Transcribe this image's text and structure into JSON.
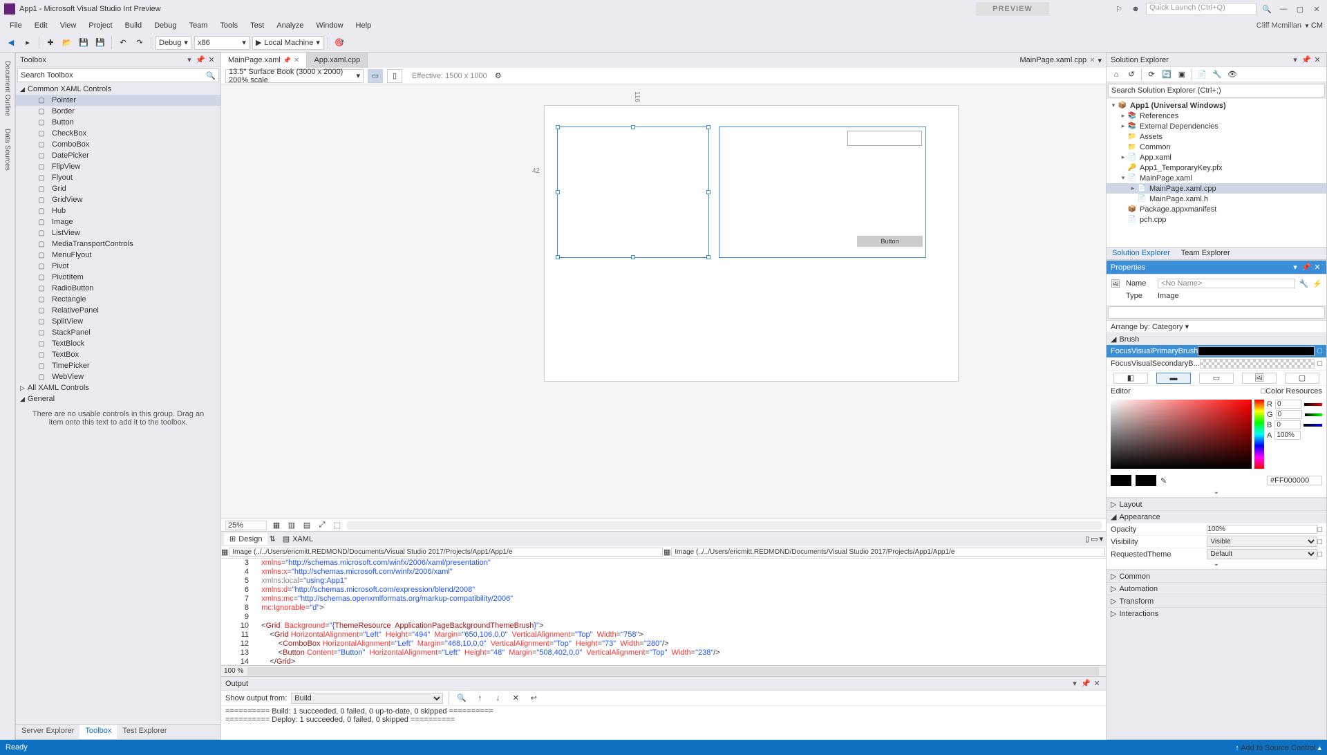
{
  "titlebar": {
    "title": "App1 - Microsoft Visual Studio Int Preview",
    "preview": "PREVIEW",
    "quickLaunch": "Quick Launch (Ctrl+Q)",
    "avatar": "CM"
  },
  "menu": {
    "items": [
      "File",
      "Edit",
      "View",
      "Project",
      "Build",
      "Debug",
      "Team",
      "Tools",
      "Test",
      "Analyze",
      "Window",
      "Help"
    ],
    "user": "Cliff Mcmillan"
  },
  "toolbar": {
    "config": "Debug",
    "platform": "x86",
    "run": "Local Machine"
  },
  "leftTabs": [
    "Document Outline",
    "Data Sources"
  ],
  "toolbox": {
    "title": "Toolbox",
    "search": "Search Toolbox",
    "cat1": "Common XAML Controls",
    "items": [
      "Pointer",
      "Border",
      "Button",
      "CheckBox",
      "ComboBox",
      "DatePicker",
      "FlipView",
      "Flyout",
      "Grid",
      "GridView",
      "Hub",
      "Image",
      "ListView",
      "MediaTransportControls",
      "MenuFlyout",
      "Pivot",
      "PivotItem",
      "RadioButton",
      "Rectangle",
      "RelativePanel",
      "SplitView",
      "StackPanel",
      "TextBlock",
      "TextBox",
      "TimePicker",
      "WebView"
    ],
    "cat2": "All XAML Controls",
    "cat3": "General",
    "empty": "There are no usable controls in this group. Drag an item onto this text to add it to the toolbox.",
    "tabs": [
      "Server Explorer",
      "Toolbox",
      "Test Explorer"
    ]
  },
  "docTabs": {
    "active": "MainPage.xaml",
    "other": "App.xaml.cpp",
    "preview": "MainPage.xaml.cpp"
  },
  "designer": {
    "device": "13.5\" Surface Book (3000 x 2000) 200% scale",
    "effective": "Effective: 1500 x 1000",
    "yMarker": "116",
    "xMarker": "42",
    "buttonLabel": "Button"
  },
  "zoom": {
    "level": "25%"
  },
  "split": {
    "tabs": [
      "Design",
      "XAML"
    ]
  },
  "breadcrumb": {
    "left": "Image (../../Users/ericmitt.REDMOND/Documents/Visual Studio 2017/Projects/App1/App1/e",
    "right": "Image (../../Users/ericmitt.REDMOND/Documents/Visual Studio 2017/Projects/App1/App1/e"
  },
  "code": {
    "start": 3,
    "lines": [
      {
        "n": 3,
        "seg": [
          [
            "    ",
            "p"
          ],
          [
            "xmlns",
            "attr"
          ],
          [
            "=",
            "p"
          ],
          [
            "\"http://schemas.microsoft.com/winfx/2006/xaml/presentation\"",
            "str"
          ]
        ]
      },
      {
        "n": 4,
        "seg": [
          [
            "    ",
            "p"
          ],
          [
            "xmlns:x",
            "attr"
          ],
          [
            "=",
            "p"
          ],
          [
            "\"http://schemas.microsoft.com/winfx/2006/xaml\"",
            "str"
          ]
        ]
      },
      {
        "n": 5,
        "seg": [
          [
            "    ",
            "p"
          ],
          [
            "xmlns:local",
            "gray"
          ],
          [
            "=",
            "p"
          ],
          [
            "\"using:App1\"",
            "str"
          ]
        ]
      },
      {
        "n": 6,
        "seg": [
          [
            "    ",
            "p"
          ],
          [
            "xmlns:d",
            "attr"
          ],
          [
            "=",
            "p"
          ],
          [
            "\"http://schemas.microsoft.com/expression/blend/2008\"",
            "str"
          ]
        ]
      },
      {
        "n": 7,
        "seg": [
          [
            "    ",
            "p"
          ],
          [
            "xmlns:mc",
            "attr"
          ],
          [
            "=",
            "p"
          ],
          [
            "\"http://schemas.openxmlformats.org/markup-compatibility/2006\"",
            "str"
          ]
        ]
      },
      {
        "n": 8,
        "seg": [
          [
            "    ",
            "p"
          ],
          [
            "mc:Ignorable",
            "attr"
          ],
          [
            "=",
            "p"
          ],
          [
            "\"d\"",
            "str"
          ],
          [
            ">",
            "p"
          ]
        ]
      },
      {
        "n": 9,
        "seg": [
          [
            "",
            "p"
          ]
        ]
      },
      {
        "n": 10,
        "seg": [
          [
            "    <",
            "p"
          ],
          [
            "Grid",
            "brown"
          ],
          [
            "  ",
            "p"
          ],
          [
            "Background",
            "attr"
          ],
          [
            "=",
            "p"
          ],
          [
            "\"{",
            "str"
          ],
          [
            "ThemeResource",
            "brown"
          ],
          [
            "  ",
            "p"
          ],
          [
            "ApplicationPageBackgroundThemeBrush",
            "brown"
          ],
          [
            "}\"",
            "str"
          ],
          [
            ">",
            "p"
          ]
        ]
      },
      {
        "n": 11,
        "seg": [
          [
            "        <",
            "p"
          ],
          [
            "Grid",
            "brown"
          ],
          [
            " ",
            "p"
          ],
          [
            "HorizontalAlignment",
            "attr"
          ],
          [
            "=",
            "p"
          ],
          [
            "\"Left\"",
            "str"
          ],
          [
            "  ",
            "p"
          ],
          [
            "Height",
            "attr"
          ],
          [
            "=",
            "p"
          ],
          [
            "\"494\"",
            "str"
          ],
          [
            "  ",
            "p"
          ],
          [
            "Margin",
            "attr"
          ],
          [
            "=",
            "p"
          ],
          [
            "\"650,106,0,0\"",
            "str"
          ],
          [
            "  ",
            "p"
          ],
          [
            "VerticalAlignment",
            "attr"
          ],
          [
            "=",
            "p"
          ],
          [
            "\"Top\"",
            "str"
          ],
          [
            "  ",
            "p"
          ],
          [
            "Width",
            "attr"
          ],
          [
            "=",
            "p"
          ],
          [
            "\"758\"",
            "str"
          ],
          [
            ">",
            "p"
          ]
        ]
      },
      {
        "n": 12,
        "seg": [
          [
            "            <",
            "p"
          ],
          [
            "ComboBox",
            "brown"
          ],
          [
            " ",
            "p"
          ],
          [
            "HorizontalAlignment",
            "attr"
          ],
          [
            "=",
            "p"
          ],
          [
            "\"Left\"",
            "str"
          ],
          [
            "  ",
            "p"
          ],
          [
            "Margin",
            "attr"
          ],
          [
            "=",
            "p"
          ],
          [
            "\"468,10,0,0\"",
            "str"
          ],
          [
            "  ",
            "p"
          ],
          [
            "VerticalAlignment",
            "attr"
          ],
          [
            "=",
            "p"
          ],
          [
            "\"Top\"",
            "str"
          ],
          [
            "  ",
            "p"
          ],
          [
            "Height",
            "attr"
          ],
          [
            "=",
            "p"
          ],
          [
            "\"73\"",
            "str"
          ],
          [
            "  ",
            "p"
          ],
          [
            "Width",
            "attr"
          ],
          [
            "=",
            "p"
          ],
          [
            "\"280\"",
            "str"
          ],
          [
            "/>",
            "p"
          ]
        ]
      },
      {
        "n": 13,
        "seg": [
          [
            "            <",
            "p"
          ],
          [
            "Button",
            "brown"
          ],
          [
            " ",
            "p"
          ],
          [
            "Content",
            "attr"
          ],
          [
            "=",
            "p"
          ],
          [
            "\"Button\"",
            "str"
          ],
          [
            "  ",
            "p"
          ],
          [
            "HorizontalAlignment",
            "attr"
          ],
          [
            "=",
            "p"
          ],
          [
            "\"Left\"",
            "str"
          ],
          [
            "  ",
            "p"
          ],
          [
            "Height",
            "attr"
          ],
          [
            "=",
            "p"
          ],
          [
            "\"48\"",
            "str"
          ],
          [
            "  ",
            "p"
          ],
          [
            "Margin",
            "attr"
          ],
          [
            "=",
            "p"
          ],
          [
            "\"508,402,0,0\"",
            "str"
          ],
          [
            "  ",
            "p"
          ],
          [
            "VerticalAlignment",
            "attr"
          ],
          [
            "=",
            "p"
          ],
          [
            "\"Top\"",
            "str"
          ],
          [
            "  ",
            "p"
          ],
          [
            "Width",
            "attr"
          ],
          [
            "=",
            "p"
          ],
          [
            "\"238\"",
            "str"
          ],
          [
            "/>",
            "p"
          ]
        ]
      },
      {
        "n": 14,
        "seg": [
          [
            "        </",
            "p"
          ],
          [
            "Grid",
            "brown"
          ],
          [
            ">",
            "p"
          ]
        ]
      }
    ],
    "pct": "100 %"
  },
  "output": {
    "title": "Output",
    "showFrom": "Show output from:",
    "source": "Build",
    "lines": [
      "========== Build: 1 succeeded, 0 failed, 0 up-to-date, 0 skipped ==========",
      "========== Deploy: 1 succeeded, 0 failed, 0 skipped =========="
    ]
  },
  "solExp": {
    "title": "Solution Explorer",
    "search": "Search Solution Explorer (Ctrl+;)",
    "nodes": [
      {
        "d": 0,
        "exp": "▾",
        "icn": "📦",
        "label": "App1 (Universal Windows)",
        "bold": true
      },
      {
        "d": 1,
        "exp": "▸",
        "icn": "📚",
        "label": "References"
      },
      {
        "d": 1,
        "exp": "▸",
        "icn": "📚",
        "label": "External Dependencies"
      },
      {
        "d": 1,
        "exp": "",
        "icn": "📁",
        "label": "Assets"
      },
      {
        "d": 1,
        "exp": "",
        "icn": "📁",
        "label": "Common"
      },
      {
        "d": 1,
        "exp": "▸",
        "icn": "📄",
        "label": "App.xaml"
      },
      {
        "d": 1,
        "exp": "",
        "icn": "🔑",
        "label": "App1_TemporaryKey.pfx"
      },
      {
        "d": 1,
        "exp": "▾",
        "icn": "📄",
        "label": "MainPage.xaml"
      },
      {
        "d": 2,
        "exp": "▸",
        "icn": "📄",
        "label": "MainPage.xaml.cpp",
        "sel": true
      },
      {
        "d": 2,
        "exp": "",
        "icn": "📄",
        "label": "MainPage.xaml.h"
      },
      {
        "d": 1,
        "exp": "",
        "icn": "📦",
        "label": "Package.appxmanifest"
      },
      {
        "d": 1,
        "exp": "",
        "icn": "📄",
        "label": "pch.cpp"
      }
    ],
    "tabs": [
      "Solution Explorer",
      "Team Explorer"
    ]
  },
  "props": {
    "title": "Properties",
    "name": "Name",
    "nameVal": "<No Name>",
    "type": "Type",
    "typeVal": "Image",
    "arrange": "Arrange by: Category",
    "brushCat": "Brush",
    "brushRows": [
      "FocusVisualPrimaryBrush",
      "FocusVisualSecondaryB..."
    ],
    "editor": "Editor",
    "colorRes": "Color Resources",
    "r": "R",
    "g": "G",
    "b": "B",
    "a": "A",
    "rVal": "0",
    "gVal": "0",
    "bVal": "0",
    "aVal": "100%",
    "hex": "#FF000000",
    "cats": [
      {
        "k": "Layout",
        "collapsed": true
      },
      {
        "k": "Appearance",
        "collapsed": false
      },
      {
        "k": "Common",
        "collapsed": true
      },
      {
        "k": "Automation",
        "collapsed": true
      },
      {
        "k": "Transform",
        "collapsed": true
      },
      {
        "k": "Interactions",
        "collapsed": true
      }
    ],
    "opacity": "Opacity",
    "opacityVal": "100%",
    "visibility": "Visibility",
    "visibilityVal": "Visible",
    "reqTheme": "RequestedTheme",
    "reqThemeVal": "Default"
  },
  "status": {
    "ready": "Ready",
    "src": "Add to Source Control"
  }
}
